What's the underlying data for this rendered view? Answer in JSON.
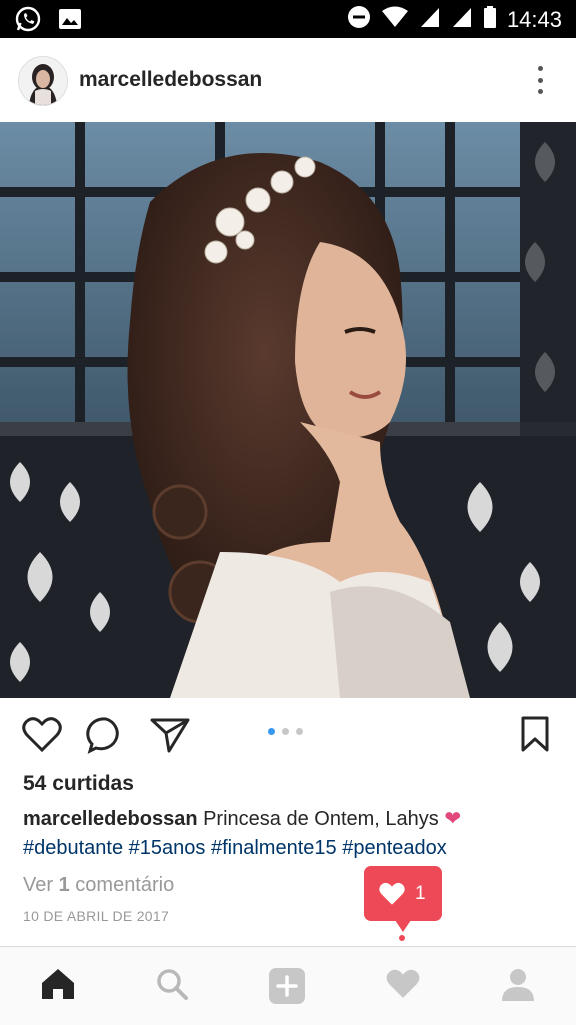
{
  "status_bar": {
    "time": "14:43",
    "icons": [
      "whatsapp-icon",
      "gallery-icon",
      "do-not-disturb-icon",
      "wifi-icon",
      "signal-icon",
      "signal-icon",
      "battery-icon"
    ]
  },
  "post": {
    "username": "marcelledebossan",
    "likes": "54 curtidas",
    "caption": {
      "username": "marcelledebossan",
      "text": "Princesa de Ontem, Lahys",
      "heart": "❤",
      "hashtags": [
        "#debutante",
        "#15anos",
        "#finalmente15",
        "#penteadox"
      ]
    },
    "comments": {
      "prefix": "Ver",
      "count": "1",
      "suffix": "comentário"
    },
    "date": "10 DE ABRIL DE 2017",
    "carousel": {
      "total": 3,
      "active": 0
    }
  },
  "notification": {
    "likes_count": "1",
    "icon": "heart-icon"
  },
  "bottom_nav": {
    "items": [
      "home-icon",
      "search-icon",
      "add-icon",
      "activity-icon",
      "profile-icon"
    ],
    "active": "home-icon"
  },
  "colors": {
    "accent_blue": "#3897f0",
    "hashtag": "#003569",
    "notification_red": "#ed4956",
    "heart_pink": "#e2487b"
  }
}
